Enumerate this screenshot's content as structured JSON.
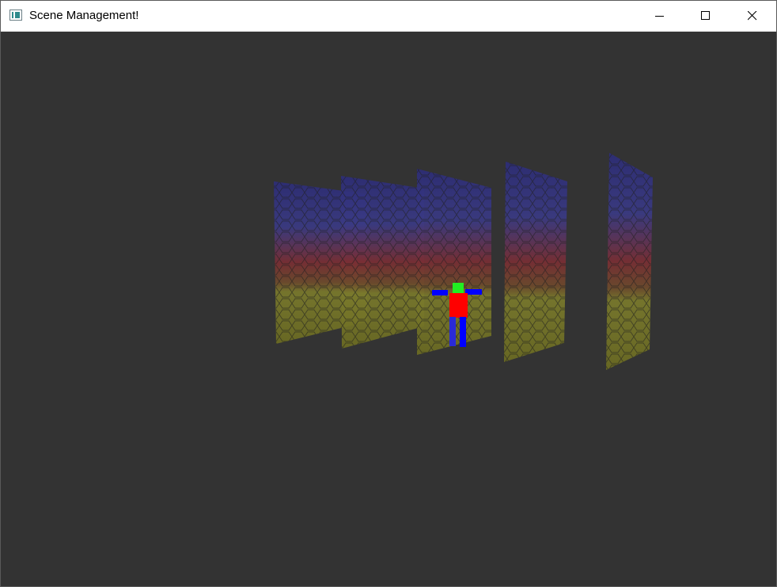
{
  "window": {
    "title": "Scene Management!",
    "controls": {
      "minimize_icon": "minimize-icon",
      "maximize_icon": "maximize-icon",
      "close_icon": "close-icon"
    }
  },
  "scene": {
    "background_color": "#333333",
    "panel_count": 5,
    "panel_gradient": [
      "#2f2f7a",
      "#7a2f2f",
      "#7a7a2a"
    ],
    "character_colors": {
      "head": "#22ee22",
      "torso": "#ff0000",
      "limbs": "#0000ff"
    }
  }
}
